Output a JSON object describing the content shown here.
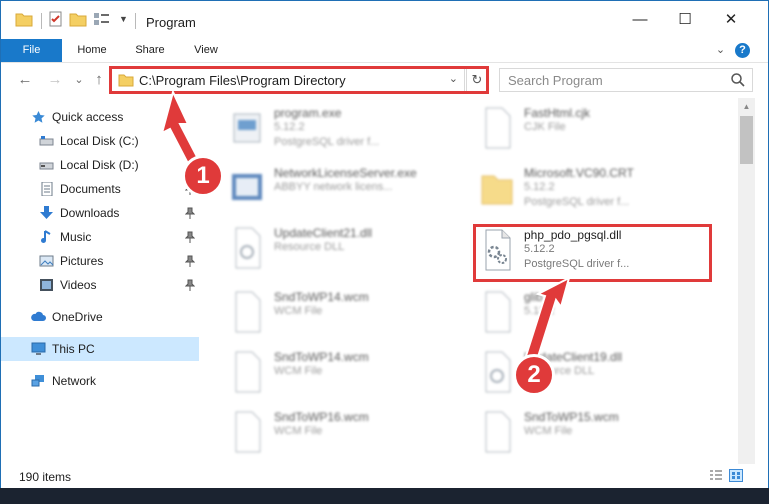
{
  "window": {
    "title": "Program",
    "controls": {
      "minimize": "—",
      "maximize": "☐",
      "close": "✕"
    }
  },
  "ribbon": {
    "tabs": [
      "File",
      "Home",
      "Share",
      "View"
    ],
    "collapse_glyph": "⌄",
    "help_glyph": "?"
  },
  "address": {
    "path": "C:\\Program Files\\Program Directory",
    "search_placeholder": "Search Program",
    "dropdown_glyph": "⌄",
    "refresh_glyph": "↻",
    "nav_glyphs": {
      "back": "←",
      "forward": "→",
      "recent": "⌄",
      "up": "↑"
    }
  },
  "nav": {
    "items": [
      {
        "label": "Quick access",
        "icon": "star-icon",
        "pinned": false
      },
      {
        "label": "Local Disk (C:)",
        "icon": "drive-icon",
        "pinned": false
      },
      {
        "label": "Local Disk (D:)",
        "icon": "drive-icon",
        "pinned": false
      },
      {
        "label": "Documents",
        "icon": "documents-icon",
        "pinned": true
      },
      {
        "label": "Downloads",
        "icon": "downloads-icon",
        "pinned": true
      },
      {
        "label": "Music",
        "icon": "music-icon",
        "pinned": true
      },
      {
        "label": "Pictures",
        "icon": "pictures-icon",
        "pinned": true
      },
      {
        "label": "Videos",
        "icon": "videos-icon",
        "pinned": true
      },
      {
        "label": "OneDrive",
        "icon": "cloud-icon",
        "pinned": false
      },
      {
        "label": "This PC",
        "icon": "computer-icon",
        "pinned": false,
        "selected": true
      },
      {
        "label": "Network",
        "icon": "network-icon",
        "pinned": false
      }
    ]
  },
  "files": [
    {
      "name": "program.exe",
      "version": "5.12.2",
      "desc": "PostgreSQL driver f...",
      "icon": "exe-icon"
    },
    {
      "name": "FastHtml.cjk",
      "version": "CJK File",
      "desc": "",
      "icon": "file-icon"
    },
    {
      "name": "NetworkLicenseServer.exe",
      "version": "ABBYY network licens...",
      "desc": "",
      "icon": "exe-icon"
    },
    {
      "name": "Microsoft.VC90.CRT",
      "version": "5.12.2",
      "desc": "PostgreSQL driver f...",
      "icon": "folder-icon"
    },
    {
      "name": "UpdateClient21.dll",
      "version": "Resource DLL",
      "desc": "",
      "icon": "dll-icon"
    },
    {
      "name": "php_pdo_pgsql.dll",
      "version": "5.12.2",
      "desc": "PostgreSQL driver f...",
      "icon": "dll-icon"
    },
    {
      "name": "SndToWP14.wcm",
      "version": "WCM File",
      "desc": "",
      "icon": "file-icon"
    },
    {
      "name": "glib",
      "version": "5.12.2",
      "desc": "",
      "icon": "file-icon"
    },
    {
      "name": "SndToWP14.wcm",
      "version": "WCM File",
      "desc": "",
      "icon": "file-icon"
    },
    {
      "name": "UpdateClient19.dll",
      "version": "Resource DLL",
      "desc": "",
      "icon": "dll-icon"
    },
    {
      "name": "SndToWP16.wcm",
      "version": "WCM File",
      "desc": "",
      "icon": "file-icon"
    },
    {
      "name": "SndToWP15.wcm",
      "version": "WCM File",
      "desc": "",
      "icon": "file-icon"
    }
  ],
  "status": {
    "item_count": "190 items"
  },
  "callouts": {
    "step1": "1",
    "step2": "2"
  },
  "colors": {
    "accent": "#1979ca",
    "highlight": "#e03a3a",
    "selection": "#cce8ff"
  }
}
